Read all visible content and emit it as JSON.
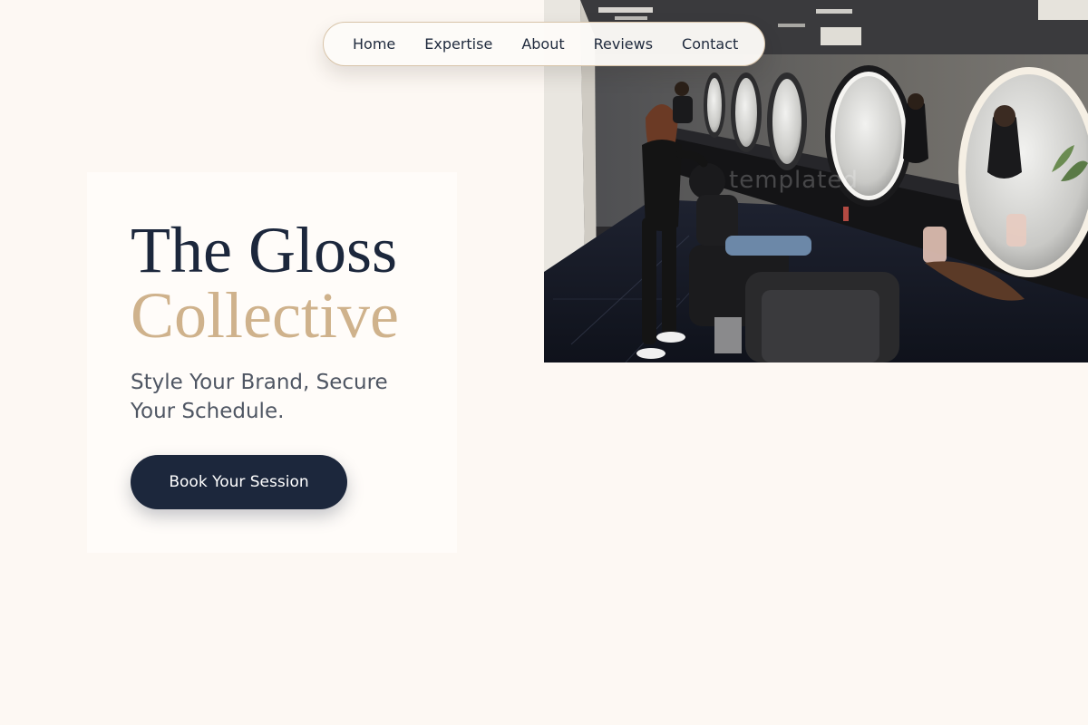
{
  "nav": {
    "items": [
      {
        "label": "Home"
      },
      {
        "label": "Expertise"
      },
      {
        "label": "About"
      },
      {
        "label": "Reviews"
      },
      {
        "label": "Contact"
      }
    ]
  },
  "hero": {
    "title_line1": "The Gloss",
    "title_line2": "Collective",
    "tagline": "Style Your Brand, Secure Your Schedule.",
    "cta_label": "Book Your Session"
  },
  "photo": {
    "watermark": "templated"
  },
  "colors": {
    "page_background": "#fdf8f3",
    "navy": "#1c273c",
    "gold": "#cfb28c",
    "muted_text": "#4f5663",
    "nav_border": "#d8c4a9"
  }
}
